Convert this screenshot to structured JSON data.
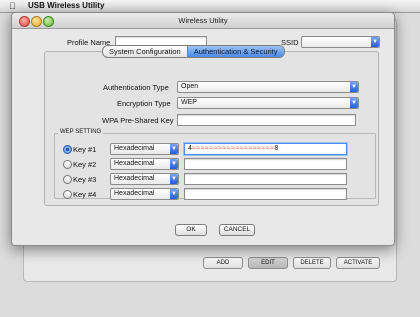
{
  "menubar": {
    "apple_icon": "apple-icon",
    "app_name": "USB Wireless Utility"
  },
  "background": {
    "buttons": {
      "add": "ADD",
      "edit": "EDIT",
      "delete": "DELETE",
      "activate": "ACTIVATE"
    }
  },
  "dialog": {
    "title": "Wireless Utility",
    "profile_name": {
      "label": "Profile Name",
      "value": ""
    },
    "ssid": {
      "label": "SSID",
      "value": ""
    },
    "tabs": [
      {
        "label": "System Configuration",
        "active": false
      },
      {
        "label": "Authentication & Security",
        "active": true
      }
    ],
    "authentication_type": {
      "label": "Authentication Type",
      "value": "Open"
    },
    "encryption_type": {
      "label": "Encryption Type",
      "value": "WEP"
    },
    "wpa_psk": {
      "label": "WPA Pre-Shared Key",
      "value": ""
    },
    "wep": {
      "title": "WEP SETTING",
      "keys": [
        {
          "label": "Key #1",
          "format": "Hexadecimal",
          "value": "4",
          "value_end": "8",
          "selected": true
        },
        {
          "label": "Key #2",
          "format": "Hexadecimal",
          "value": "",
          "selected": false
        },
        {
          "label": "Key #3",
          "format": "Hexadecimal",
          "value": "",
          "selected": false
        },
        {
          "label": "Key #4",
          "format": "Hexadecimal",
          "value": "",
          "selected": false
        }
      ]
    },
    "buttons": {
      "ok": "OK",
      "cancel": "CANCEL"
    }
  },
  "colors": {
    "accent": "#4a8ae6",
    "select_arrow": "#1f5fd6",
    "scribble": "#d5553a"
  }
}
